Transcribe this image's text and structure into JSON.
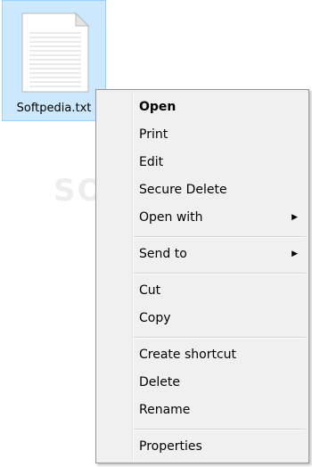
{
  "file": {
    "name": "Softpedia.txt",
    "icon": "text-file-icon"
  },
  "watermark": "SOFTPEDIA",
  "context_menu": {
    "items": [
      {
        "label": "Open",
        "bold": true
      },
      {
        "label": "Print"
      },
      {
        "label": "Edit"
      },
      {
        "label": "Secure Delete"
      },
      {
        "label": "Open with",
        "submenu": true
      },
      {
        "label": "Send to",
        "submenu": true
      },
      {
        "label": "Cut"
      },
      {
        "label": "Copy"
      },
      {
        "label": "Create shortcut"
      },
      {
        "label": "Delete"
      },
      {
        "label": "Rename"
      },
      {
        "label": "Properties"
      }
    ],
    "submenu_arrow": "▶"
  },
  "colors": {
    "selection_background": "#cce8ff",
    "selection_border": "#99d1ff",
    "menu_background": "#f0f0f0",
    "menu_border": "#979797"
  }
}
